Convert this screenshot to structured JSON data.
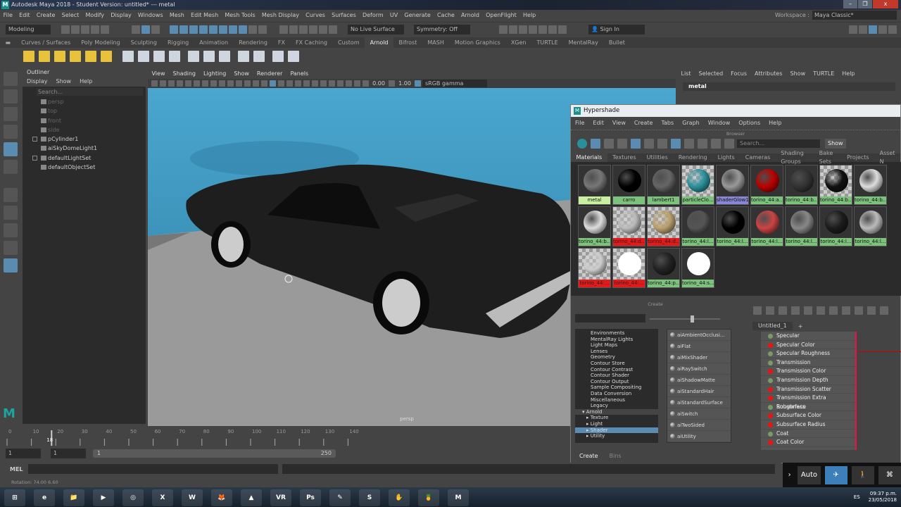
{
  "window": {
    "title": "Autodesk Maya 2018 - Student Version: untitled*   ---   metal",
    "logo": "M",
    "minimize": "–",
    "maximize": "❐",
    "close": "x"
  },
  "menubar": [
    "File",
    "Edit",
    "Create",
    "Select",
    "Modify",
    "Display",
    "Windows",
    "Mesh",
    "Edit Mesh",
    "Mesh Tools",
    "Mesh Display",
    "Curves",
    "Surfaces",
    "Deform",
    "UV",
    "Generate",
    "Cache",
    "Arnold",
    "OpenFlight",
    "Help"
  ],
  "workspace": {
    "label": "Workspace :",
    "value": "Maya Classic*"
  },
  "statusline": {
    "mode": "Modeling",
    "live_surface": "No Live Surface",
    "symmetry": "Symmetry: Off",
    "sign_in": "Sign In"
  },
  "shelf_tabs": [
    "Curves / Surfaces",
    "Poly Modeling",
    "Sculpting",
    "Rigging",
    "Animation",
    "Rendering",
    "FX",
    "FX Caching",
    "Custom",
    "Arnold",
    "Bifrost",
    "MASH",
    "Motion Graphics",
    "XGen",
    "TURTLE",
    "MentalRay",
    "Bullet"
  ],
  "shelf_active": "Arnold",
  "outliner": {
    "title": "Outliner",
    "menu": [
      "Display",
      "Show",
      "Help"
    ],
    "search_placeholder": "Search...",
    "items": [
      {
        "label": "persp",
        "dim": true
      },
      {
        "label": "top",
        "dim": true
      },
      {
        "label": "front",
        "dim": true
      },
      {
        "label": "side",
        "dim": true
      },
      {
        "label": "pCylinder1",
        "expand": true
      },
      {
        "label": "aiSkyDomeLight1"
      },
      {
        "label": "defaultLightSet",
        "expand": true
      },
      {
        "label": "defaultObjectSet"
      }
    ]
  },
  "viewport": {
    "menu": [
      "View",
      "Shading",
      "Lighting",
      "Show",
      "Renderer",
      "Panels"
    ],
    "exposure": "0.00",
    "gamma": "1.00",
    "color_space": "sRGB gamma",
    "camera_label": "persp"
  },
  "channel_box": {
    "menu": [
      "List",
      "Selected",
      "Focus",
      "Attributes",
      "Show",
      "TURTLE",
      "Help"
    ],
    "node": "metal"
  },
  "hypershade": {
    "title": "Hypershade",
    "logo": "M",
    "menu": [
      "File",
      "Edit",
      "View",
      "Create",
      "Tabs",
      "Graph",
      "Window",
      "Options",
      "Help"
    ],
    "browser_label": "Browser",
    "search_placeholder": "Search...",
    "show_button": "Show",
    "tabs": [
      "Materials",
      "Textures",
      "Utilities",
      "Rendering",
      "Lights",
      "Cameras",
      "Shading Groups",
      "Bake Sets",
      "Projects",
      "Asset N"
    ],
    "materials": [
      {
        "label": "metal",
        "ball": "#777",
        "state": "sel"
      },
      {
        "label": "carro",
        "ball": "#000",
        "state": "ok"
      },
      {
        "label": "lambert1",
        "ball": "#666",
        "state": "ok"
      },
      {
        "label": "particleClo...",
        "ball": "#2a8f9a",
        "state": "ok",
        "check": true
      },
      {
        "label": "shaderGlow1",
        "ball": "#999",
        "state": "blue"
      },
      {
        "label": "torino_44:a...",
        "ball": "#b00",
        "state": "ok"
      },
      {
        "label": "torino_44:b...",
        "ball": "#333",
        "state": "ok"
      },
      {
        "label": "torino_44:b...",
        "ball": "#111",
        "state": "ok",
        "check": true
      },
      {
        "label": "torino_44:b...",
        "ball": "#ddd",
        "state": "ok"
      },
      {
        "label": "torino_44:b...",
        "ball": "#ddd",
        "state": "ok"
      },
      {
        "label": "torino_44:d...",
        "ball": "#bbb",
        "state": "red",
        "check": true
      },
      {
        "label": "torino_44:d...",
        "ball": "#b9a070",
        "state": "red",
        "check": true
      },
      {
        "label": "torino_44:l...",
        "ball": "#555",
        "state": "ok"
      },
      {
        "label": "torino_44:l...",
        "ball": "#000",
        "state": "ok"
      },
      {
        "label": "torino_44:l...",
        "ball": "#c44",
        "state": "ok"
      },
      {
        "label": "torino_44:l...",
        "ball": "#888",
        "state": "ok"
      },
      {
        "label": "torino_44:l...",
        "ball": "#1c1c1c",
        "state": "ok"
      },
      {
        "label": "torino_44:l...",
        "ball": "#bbb",
        "state": "ok"
      },
      {
        "label": "torino_44:...",
        "ball": "#ccc",
        "state": "red",
        "check": true
      },
      {
        "label": "torino_44:...",
        "ball": "#fff",
        "state": "red",
        "check": true
      },
      {
        "label": "torino_44:p...",
        "ball": "#222",
        "state": "ok"
      },
      {
        "label": "torino_44:s...",
        "ball": "#fff",
        "state": "ok"
      }
    ],
    "create_label": "Create",
    "categories": [
      {
        "label": "Environments"
      },
      {
        "label": "MentalRay Lights"
      },
      {
        "label": "Light Maps"
      },
      {
        "label": "Lenses"
      },
      {
        "label": "Geometry"
      },
      {
        "label": "Contour Store"
      },
      {
        "label": "Contour Contrast"
      },
      {
        "label": "Contour Shader"
      },
      {
        "label": "Contour Output"
      },
      {
        "label": "Sample Compositing"
      },
      {
        "label": "Data Conversion"
      },
      {
        "label": "Miscellaneous"
      },
      {
        "label": "Legacy"
      },
      {
        "label": "▾ Arnold",
        "grp": true
      },
      {
        "label": "▸ Texture",
        "sub": true
      },
      {
        "label": "▸ Light",
        "sub": true
      },
      {
        "label": "▸ Shader",
        "sub": true,
        "act": true
      },
      {
        "label": "▸ Utility",
        "sub": true
      }
    ],
    "nodes": [
      "aiAmbientOcclusi...",
      "aiFlat",
      "aiMixShader",
      "aiRaySwitch",
      "aiShadowMatte",
      "aiStandardHair",
      "aiStandardSurface",
      "aiSwitch",
      "aiTwoSided",
      "aiUtility"
    ],
    "graph_tab": "Untitled_1",
    "add_tab": "+",
    "attributes": [
      {
        "l": "Specular",
        "r": false
      },
      {
        "l": "Specular Color",
        "r": true
      },
      {
        "l": "Specular Roughness",
        "r": false
      },
      {
        "l": "Transmission",
        "r": false
      },
      {
        "l": "Transmission Color",
        "r": true
      },
      {
        "l": "Transmission Depth",
        "r": false
      },
      {
        "l": "Transmission Scatter",
        "r": true
      },
      {
        "l": "Transmission Extra Roughness",
        "r": true
      },
      {
        "l": "Subsurface",
        "r": false
      },
      {
        "l": "Subsurface Color",
        "r": true
      },
      {
        "l": "Subsurface Radius",
        "r": true
      },
      {
        "l": "Coat",
        "r": false
      },
      {
        "l": "Coat Color",
        "r": true
      }
    ],
    "bottom_tabs": [
      "Create",
      "Bins"
    ]
  },
  "timeline": {
    "ticks": [
      "0",
      "10",
      "20",
      "30",
      "40",
      "50",
      "60",
      "70",
      "80",
      "90",
      "100",
      "110",
      "120",
      "130",
      "140"
    ],
    "current_frame": "18",
    "start": "1",
    "start2": "1",
    "range_start": "1",
    "range_end": "250"
  },
  "mel": {
    "label": "MEL"
  },
  "helpline": "Rotation:   74.00      6.60",
  "shelf2": {
    "auto": "Auto"
  },
  "taskbar": {
    "apps": [
      "⊞",
      "e",
      "📁",
      "▶",
      "◎",
      "X",
      "W",
      "🦊",
      "▲",
      "VR",
      "Ps",
      "✎",
      "S",
      "✋",
      "🍍",
      "M"
    ],
    "lang": "ES",
    "time": "09:37 p.m.",
    "date": "23/05/2018"
  }
}
